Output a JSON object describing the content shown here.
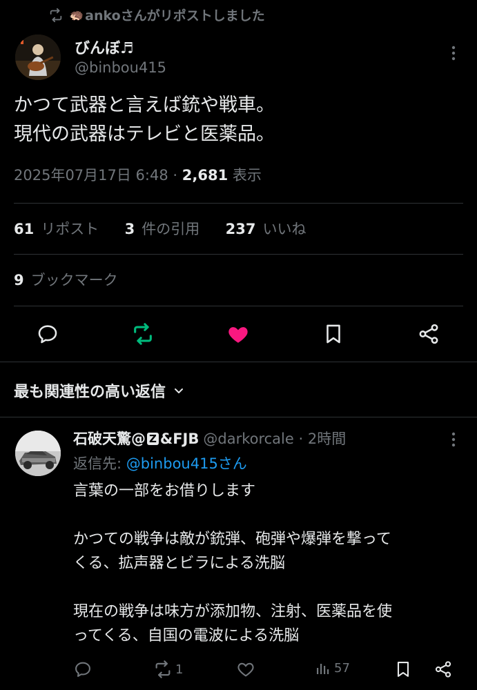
{
  "repost": {
    "label": "ankoさんがリポストしました",
    "hedgehog": "🦔"
  },
  "tweet": {
    "author_name": "びんぼ♬",
    "author_handle": "@binbou415",
    "text_lines": [
      "かつて武器と言えば銃や戦車。",
      "現代の武器はテレビと医薬品。"
    ],
    "timestamp": "2025年07月17日 6:48",
    "separator": "·",
    "views_count": "2,681",
    "views_label": "表示",
    "reposts_count": "61",
    "reposts_label": "リポスト",
    "quotes_count": "3",
    "quotes_label": "件の引用",
    "likes_count": "237",
    "likes_label": "いいね",
    "bookmarks_count": "9",
    "bookmarks_label": "ブックマーク"
  },
  "colors": {
    "repost_active": "#00ba7c",
    "like_active": "#f91880",
    "link": "#1d9bf0",
    "muted": "#71767b"
  },
  "replies_section": {
    "title": "最も関連性の高い返信"
  },
  "reply": {
    "name_prefix": "石破天驚@",
    "name_z": "Z",
    "name_suffix": "&FJB",
    "handle": "@darkorcale",
    "separator": "·",
    "time": "2時間",
    "reply_to_label": "返信先:",
    "reply_to_mention": "@binbou415さん",
    "body_lines": [
      "言葉の一部をお借りします",
      "",
      "かつての戦争は敵が銃弾、砲弾や爆弾を撃って",
      "くる、拡声器とビラによる洗脳",
      "",
      "現在の戦争は味方が添加物、注射、医薬品を使",
      "ってくる、自国の電波による洗脳"
    ],
    "repost_count": "1",
    "views_count": "57"
  }
}
